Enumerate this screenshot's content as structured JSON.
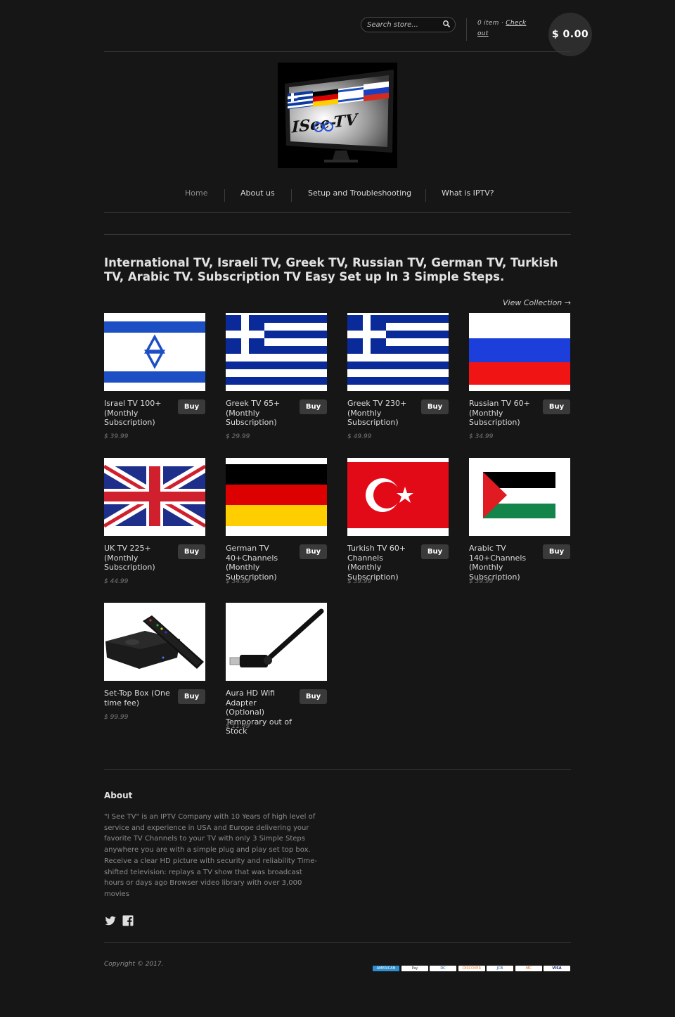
{
  "header": {
    "search_placeholder": "Search store...",
    "cart_items": "0 item",
    "cart_sep": "·",
    "checkout": "Check out",
    "cart_total": "$ 0.00"
  },
  "nav": {
    "items": [
      {
        "label": "Home",
        "active": true
      },
      {
        "label": "About us"
      },
      {
        "label": "Setup and Troubleshooting"
      },
      {
        "label": "What is IPTV?"
      }
    ]
  },
  "headline": "International TV, Israeli TV, Greek TV, Russian TV, German TV, Turkish TV, Arabic TV. Subscription TV Easy Set up In 3 Simple Steps.",
  "view_collection": "View Collection →",
  "buy_label": "Buy",
  "products": [
    {
      "name": "Israel TV 100+ (Monthly Subscription)",
      "price": "$ 39.99",
      "image": "israel-flag"
    },
    {
      "name": "Greek TV 65+ (Monthly Subscription)",
      "price": "$ 29.99",
      "image": "greece-flag"
    },
    {
      "name": "Greek TV 230+ (Monthly Subscription)",
      "price": "$ 49.99",
      "image": "greece-flag"
    },
    {
      "name": "Russian TV 60+ (Monthly Subscription)",
      "price": "$ 34.99",
      "image": "russia-flag"
    },
    {
      "name": "UK TV 225+ (Monthly Subscription)",
      "price": "$ 44.99",
      "image": "uk-flag"
    },
    {
      "name": "German TV 40+Channels (Monthly Subscription)",
      "price": "$ 34.99",
      "image": "germany-flag"
    },
    {
      "name": "Turkish TV 60+ Channels (Monthly Subscription)",
      "price": "$ 39.99",
      "image": "turkey-flag"
    },
    {
      "name": "Arabic TV 140+Channels (Monthly Subscription)",
      "price": "$ 39.99",
      "image": "palestine-flag"
    },
    {
      "name": "Set-Top Box (One time fee)",
      "price": "$ 99.99",
      "image": "set-top-box"
    },
    {
      "name": "Aura HD Wifi Adapter (Optional) Temporary out of Stock",
      "price": "$ 11.99",
      "image": "wifi-adapter"
    }
  ],
  "footer": {
    "about_title": "About",
    "about_text": "\"I See TV\" is an IPTV Company with 10 Years of high level of service and experience in USA and Europe delivering your favorite TV Channels to your TV with only 3 Simple Steps anywhere you are with a simple plug and play set top box. Receive a clear HD picture with security and reliability Time-shifted television: replays a TV show that was broadcast hours or days ago Browser video library with over 3,000 movies",
    "copyright": "Copyright © 2017.",
    "payment_icons": [
      "american-express-icon",
      "apple-pay-icon",
      "diners-club-icon",
      "discover-icon",
      "jcb-icon",
      "master-icon",
      "visa-icon"
    ],
    "payment_labels": [
      "AMERICAN",
      "Pay",
      "DC",
      "DISCOVER",
      "JCB",
      "MC",
      "VISA"
    ]
  },
  "colors": {
    "background": "#161616",
    "button": "#3a3a3a",
    "cart_bubble": "#2d2d2d"
  }
}
